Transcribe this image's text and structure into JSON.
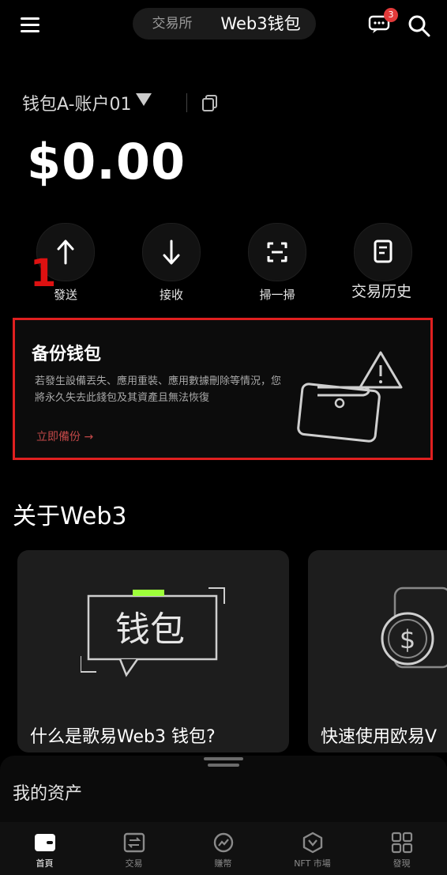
{
  "header": {
    "tabs": [
      {
        "label": "交易所",
        "active": false
      },
      {
        "label": "Web3钱包",
        "active": true
      }
    ],
    "notification_count": "3"
  },
  "wallet": {
    "account_name": "钱包A-账户01",
    "balance": "$0.00"
  },
  "actions": [
    {
      "label": "發送",
      "icon": "arrow-up-icon"
    },
    {
      "label": "接收",
      "icon": "arrow-down-icon"
    },
    {
      "label": "掃一掃",
      "icon": "scan-icon"
    },
    {
      "label": "交易历史",
      "icon": "history-icon"
    }
  ],
  "annotation": {
    "number": "1",
    "color": "#dd1111"
  },
  "backup": {
    "title": "备份钱包",
    "description": "若發生設備丟失、應用重裝、應用數據刪除等情況，您將永久失去此錢包及其資產且無法恢復",
    "link": "立即備份 →",
    "highlight_color": "#e02020"
  },
  "web3_section": {
    "title": "关于Web3",
    "cards": [
      {
        "title": "什么是歌易Web3 钱包?",
        "art_text": "钱包"
      },
      {
        "title": "快速使用欧易V"
      }
    ]
  },
  "assets": {
    "title": "我的资产"
  },
  "tabbar": [
    {
      "label": "首頁",
      "icon": "wallet-icon",
      "active": true
    },
    {
      "label": "交易",
      "icon": "trade-icon",
      "active": false
    },
    {
      "label": "賺幣",
      "icon": "earn-icon",
      "active": false
    },
    {
      "label": "NFT 市場",
      "icon": "nft-icon",
      "active": false
    },
    {
      "label": "發現",
      "icon": "discover-icon",
      "active": false
    }
  ]
}
